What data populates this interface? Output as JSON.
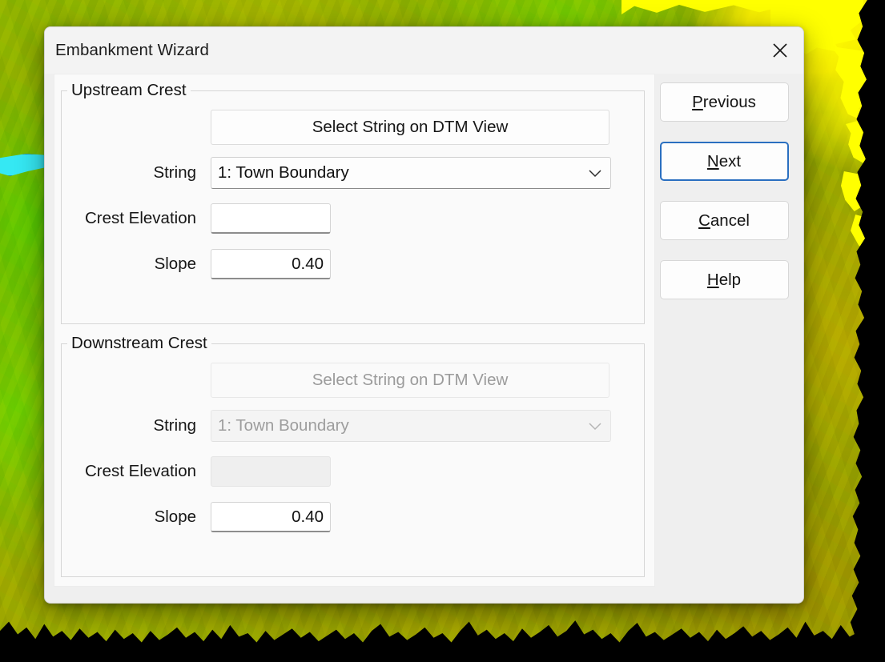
{
  "window": {
    "title": "Embankment Wizard",
    "close_icon": "close-icon"
  },
  "accent_colors": {
    "default_button_border": "#2a6fc0",
    "textbox_underline": "#8d8d8d",
    "terrain_high": "#ffff00",
    "terrain_mid": "#9ba000",
    "terrain_low": "#62c400",
    "water": "#35e8f3"
  },
  "sections": [
    {
      "id": "upstream",
      "title": "Upstream Crest",
      "enabled": true,
      "select_button": {
        "label": "Select String on DTM View",
        "enabled": true
      },
      "string": {
        "label": "String",
        "value": "1: Town Boundary",
        "enabled": true,
        "chevron_icon": "chevron-down-icon"
      },
      "crest_elevation": {
        "label": "Crest Elevation",
        "value": "",
        "enabled": true
      },
      "slope": {
        "label": "Slope",
        "value": "0.40",
        "enabled": true
      }
    },
    {
      "id": "downstream",
      "title": "Downstream Crest",
      "enabled": false,
      "select_button": {
        "label": "Select String on DTM View",
        "enabled": false
      },
      "string": {
        "label": "String",
        "value": "1: Town Boundary",
        "enabled": false,
        "chevron_icon": "chevron-down-icon"
      },
      "crest_elevation": {
        "label": "Crest Elevation",
        "value": "",
        "enabled": false
      },
      "slope": {
        "label": "Slope",
        "value": "0.40",
        "enabled": true
      }
    }
  ],
  "buttons": [
    {
      "id": "previous",
      "mnemonic": "P",
      "rest": "revious",
      "default": false
    },
    {
      "id": "next",
      "mnemonic": "N",
      "rest": "ext",
      "default": true
    },
    {
      "id": "cancel",
      "mnemonic": "C",
      "rest": "ancel",
      "default": false
    },
    {
      "id": "help",
      "mnemonic": "H",
      "rest": "elp",
      "default": false
    }
  ]
}
